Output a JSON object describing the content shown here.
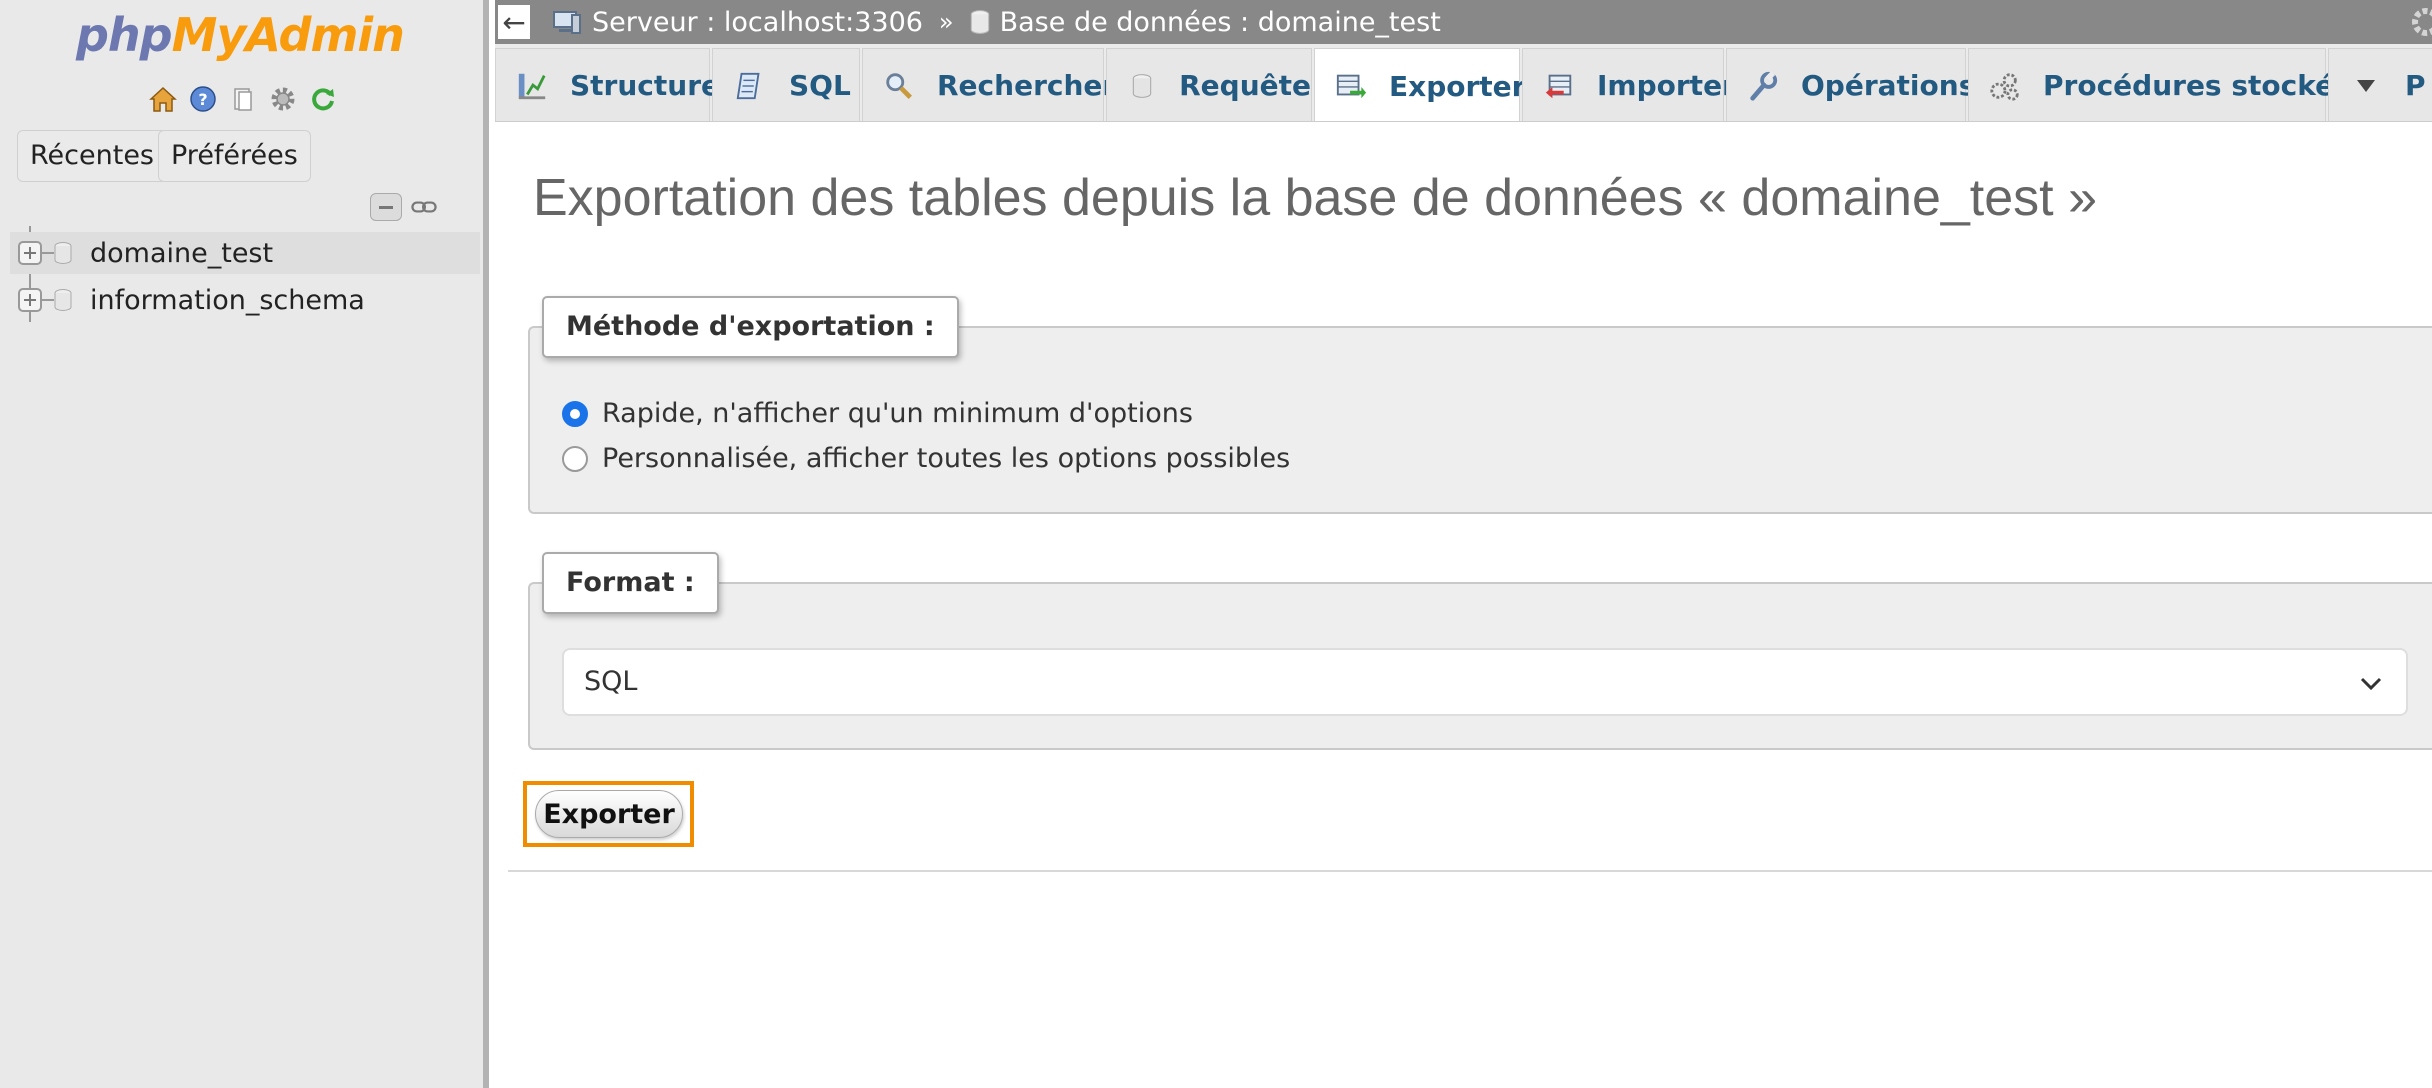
{
  "sidebar": {
    "logo": {
      "part1": "php",
      "part2": "MyAdmin"
    },
    "icons": [
      "home-icon",
      "help-icon",
      "docs-icon",
      "settings-icon",
      "reload-icon"
    ],
    "tabs": {
      "recent": "Récentes",
      "favorites": "Préférées"
    },
    "databases": [
      {
        "name": "domaine_test"
      },
      {
        "name": "information_schema"
      }
    ]
  },
  "breadcrumb": {
    "back": "←",
    "server": "Serveur : localhost:3306",
    "separator": "»",
    "database": "Base de données : domaine_test"
  },
  "tabs": [
    {
      "label": "Structure",
      "icon": "structure-icon"
    },
    {
      "label": "SQL",
      "icon": "sql-icon"
    },
    {
      "label": "Rechercher",
      "icon": "search-icon"
    },
    {
      "label": "Requête",
      "icon": "query-icon"
    },
    {
      "label": "Exporter",
      "icon": "export-icon",
      "active": true
    },
    {
      "label": "Importer",
      "icon": "import-icon"
    },
    {
      "label": "Opérations",
      "icon": "wrench-icon"
    },
    {
      "label": "Procédures stockées",
      "icon": "routines-icon"
    },
    {
      "label": "P",
      "icon": "chevron-down-icon"
    }
  ],
  "main": {
    "title": "Exportation des tables depuis la base de données « domaine_test »",
    "method": {
      "legend": "Méthode d'exportation :",
      "options": [
        {
          "label": "Rapide, n'afficher qu'un minimum d'options",
          "checked": true
        },
        {
          "label": "Personnalisée, afficher toutes les options possibles",
          "checked": false
        }
      ]
    },
    "format": {
      "legend": "Format :",
      "selected": "SQL"
    },
    "export_button": "Exporter"
  },
  "colors": {
    "accent": "#235a81",
    "highlight": "#f08c00",
    "radio": "#1a73e8",
    "logo_php": "#6c78af",
    "logo_myadmin": "#f89c0e"
  }
}
